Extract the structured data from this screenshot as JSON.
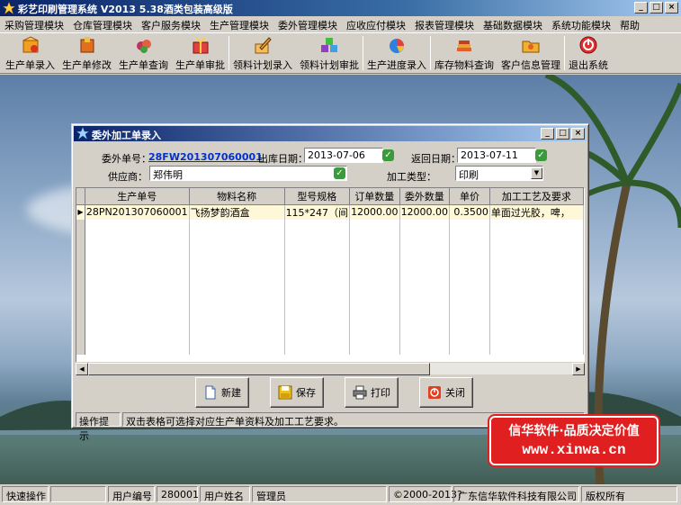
{
  "app": {
    "title": "彩艺印刷管理系统   V2013 5.38酒类包装高级版",
    "window_buttons": [
      "_",
      "□",
      "×"
    ]
  },
  "menu": [
    "采购管理模块",
    "仓库管理模块",
    "客户服务模块",
    "生产管理模块",
    "委外管理模块",
    "应收应付模块",
    "报表管理模块",
    "基础数据模块",
    "系统功能模块",
    "帮助"
  ],
  "toolbar": [
    {
      "label": "生产单录入",
      "icon": "box-add-icon",
      "color": "#f0a020"
    },
    {
      "label": "生产单修改",
      "icon": "box-edit-icon",
      "color": "#e07020"
    },
    {
      "label": "生产单查询",
      "icon": "search-fruit-icon",
      "color": "#c03060"
    },
    {
      "label": "生产单审批",
      "icon": "gift-approve-icon",
      "color": "#e04040"
    },
    {
      "label": "领料计划录入",
      "icon": "pencil-plan-icon",
      "color": "#e0a030"
    },
    {
      "label": "领料计划审批",
      "icon": "cubes-approve-icon",
      "color": "#9040c0"
    },
    {
      "label": "生产进度录入",
      "icon": "pie-chart-icon",
      "color": "#3080e0"
    },
    {
      "label": "库存物料查询",
      "icon": "books-icon",
      "color": "#e06030"
    },
    {
      "label": "客户信息管理",
      "icon": "folder-people-icon",
      "color": "#f0b030"
    },
    {
      "label": "退出系统",
      "icon": "power-exit-icon",
      "color": "#e03030"
    }
  ],
  "dialog": {
    "title": "委外加工单录入",
    "window_buttons": [
      "_",
      "□",
      "×"
    ],
    "form": {
      "order_no_label": "委外单号：",
      "order_no": "28FW201307060001",
      "out_date_label": "出库日期：",
      "out_date": "2013-07-06",
      "return_date_label": "返回日期：",
      "return_date": "2013-07-11",
      "supplier_label": "供应商：",
      "supplier": "郑伟明",
      "process_type_label": "加工类型：",
      "process_type": "印刷"
    },
    "grid": {
      "columns": [
        "生产单号",
        "物料名称",
        "型号规格",
        "订单数量",
        "委外数量",
        "单价",
        "加工工艺及要求"
      ],
      "rows": [
        [
          "28PN201307060001",
          "飞扬梦韵酒盒",
          "115*247（间",
          "12000.00",
          "12000.00",
          "0.3500",
          "单面过光胶，啤，"
        ]
      ]
    },
    "buttons": [
      {
        "label": "新建",
        "icon": "new-doc-icon"
      },
      {
        "label": "保存",
        "icon": "save-icon"
      },
      {
        "label": "打印",
        "icon": "printer-icon"
      },
      {
        "label": "关闭",
        "icon": "close-power-icon"
      }
    ],
    "hint_label": "操作提示",
    "hint_text": "双击表格可选择对应生产单资料及加工工艺要求。"
  },
  "brand": {
    "line1": "信华软件·品质决定价值",
    "line2": "www.xinwa.cn"
  },
  "status": {
    "quick_ops": "快速操作",
    "user_no_label": "用户编号",
    "user_no": "280001",
    "user_name_label": "用户姓名",
    "user_name": "管理员",
    "copyright": "©2000-2013?",
    "company": "广东信华软件科技有限公司",
    "rights": "版权所有"
  }
}
